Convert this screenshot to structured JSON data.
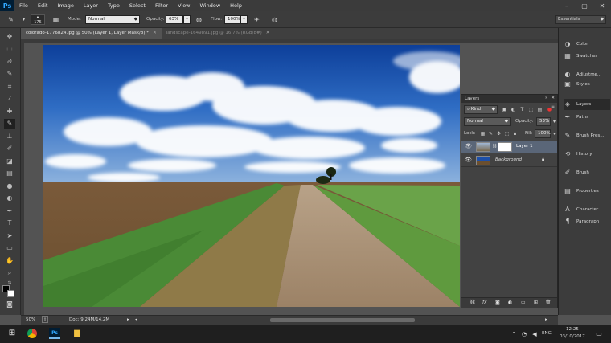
{
  "app": {
    "name": "Ps",
    "brand_color": "#31a8ff"
  },
  "menu": [
    "File",
    "Edit",
    "Image",
    "Layer",
    "Type",
    "Select",
    "Filter",
    "View",
    "Window",
    "Help"
  ],
  "options_bar": {
    "brush_size": "175",
    "mode_label": "Mode:",
    "mode_value": "Normal",
    "opacity_label": "Opacity:",
    "opacity_value": "63%",
    "flow_label": "Flow:",
    "flow_value": "100%",
    "workspace": "Essentials"
  },
  "tabs": [
    {
      "label": "colorado-1776824.jpg @ 50% (Layer 1, Layer Mask/8) *",
      "active": true
    },
    {
      "label": "landscape-1649891.jpg @ 16.7% (RGB/8#)",
      "active": false
    }
  ],
  "status": {
    "zoom": "50%",
    "doc": "Doc: 9.24M/14.2M"
  },
  "layers_panel": {
    "title": "Layers",
    "filter_value": "Kind",
    "blend_mode": "Normal",
    "opacity_label": "Opacity:",
    "opacity_value": "53%",
    "lock_label": "Lock:",
    "fill_label": "Fill:",
    "fill_value": "100%",
    "layers": [
      {
        "name": "Layer 1",
        "selected": true
      },
      {
        "name": "Background",
        "selected": false
      }
    ]
  },
  "right_dock": {
    "group1": [
      "Color",
      "Swatches"
    ],
    "group2": [
      "Adjustme...",
      "Styles"
    ],
    "group3": [
      "Layers",
      "Paths"
    ],
    "group4": [
      "Brush Pres..."
    ],
    "group5": [
      "History"
    ],
    "group6": [
      "Brush"
    ],
    "group7": [
      "Properties"
    ],
    "group8": [
      "Character",
      "Paragraph"
    ]
  },
  "taskbar": {
    "time": "12:25",
    "date": "03/10/2017",
    "lang": "ENG"
  }
}
